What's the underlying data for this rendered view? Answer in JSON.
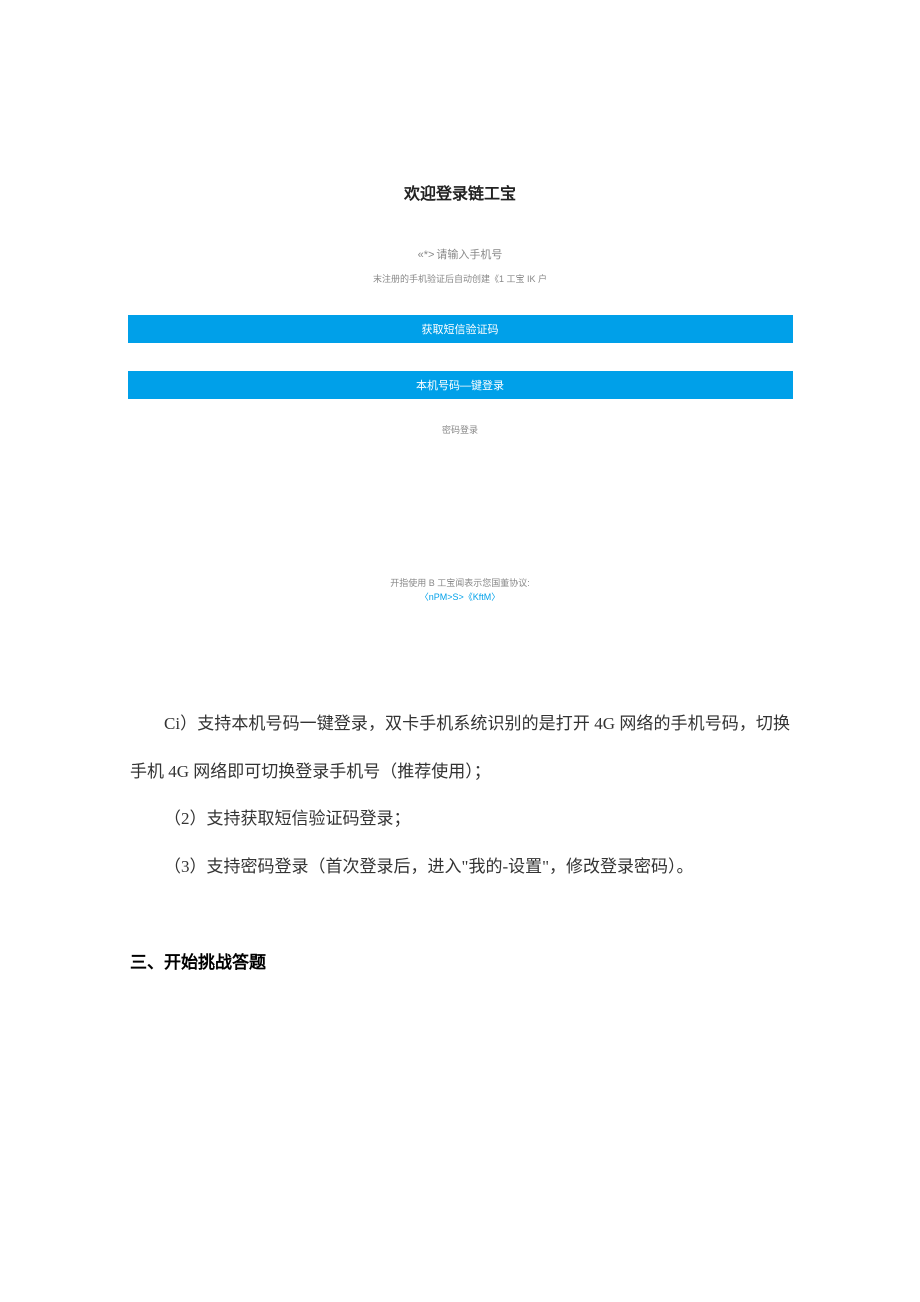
{
  "loginScreen": {
    "title": "欢迎登录链工宝",
    "phonePrefix": "«*>",
    "phonePlaceholder": "请输入手机号",
    "phoneHint": "末注册的手机验证后自动创建《1 工宝 IK 户",
    "smsButton": "获取短信验证码",
    "oneClickButton": "本机号码—键登录",
    "passwordLogin": "密码登录",
    "agreementLine1": "开指使用 B 工宝闻表示您国董协议:",
    "agreementLine2": "〈nPM>S>《KftM〉"
  },
  "document": {
    "para1": "Ci）支持本机号码一键登录，双卡手机系统识别的是打开 4G 网络的手机号码，切换手机 4G 网络即可切换登录手机号（推荐使用）；",
    "para2": "（2）支持获取短信验证码登录；",
    "para3": "（3）支持密码登录（首次登录后，进入\"我的-设置\"，修改登录密码）。",
    "section3": "三、开始挑战答题"
  }
}
